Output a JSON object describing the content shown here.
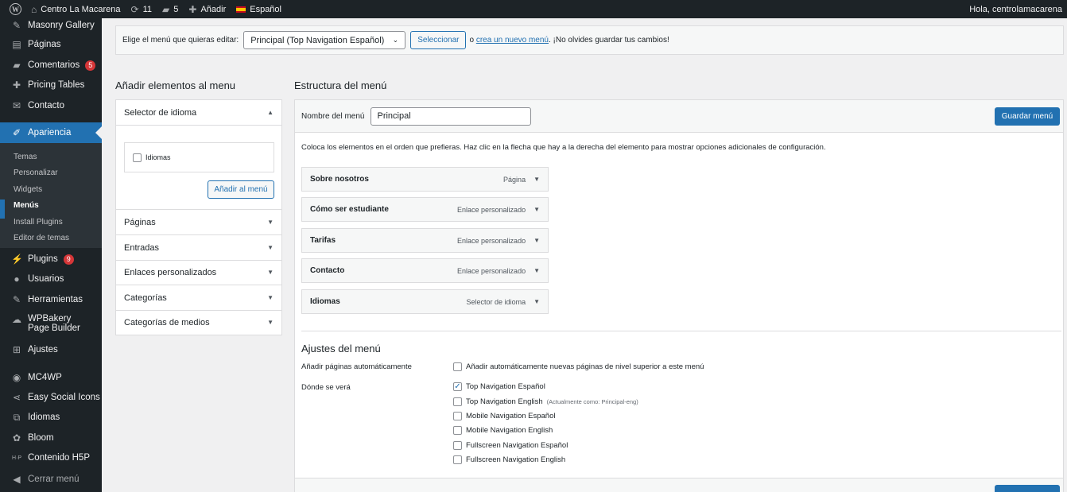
{
  "adminbar": {
    "site_name": "Centro La Macarena",
    "updates": "11",
    "comments": "5",
    "new_label": "Añadir",
    "language": "Español",
    "greeting": "Hola, centrolamacarena"
  },
  "sidebar": {
    "items": [
      {
        "label": "Masonry Gallery",
        "icon": "pin-icon"
      },
      {
        "label": "Páginas",
        "icon": "pages-icon"
      },
      {
        "label": "Comentarios",
        "icon": "comment-icon",
        "badge": "5"
      },
      {
        "label": "Pricing Tables",
        "icon": "plus-icon"
      },
      {
        "label": "Contacto",
        "icon": "mail-icon"
      },
      {
        "label": "Apariencia",
        "icon": "brush-icon"
      },
      {
        "label": "Plugins",
        "icon": "plugin-icon",
        "badge": "9"
      },
      {
        "label": "Usuarios",
        "icon": "user-icon"
      },
      {
        "label": "Herramientas",
        "icon": "wrench-icon"
      },
      {
        "label": "WPBakery Page Builder",
        "icon": "cloud-icon"
      },
      {
        "label": "Ajustes",
        "icon": "settings-icon"
      },
      {
        "label": "MC4WP",
        "icon": "mc4wp-icon"
      },
      {
        "label": "Easy Social Icons",
        "icon": "share-icon"
      },
      {
        "label": "Idiomas",
        "icon": "translate-icon"
      },
      {
        "label": "Bloom",
        "icon": "bloom-icon"
      },
      {
        "label": "Contenido H5P",
        "icon": "h5p-icon"
      },
      {
        "label": "Cerrar menú",
        "icon": "collapse-icon"
      }
    ],
    "submenu": [
      "Temas",
      "Personalizar",
      "Widgets",
      "Menús",
      "Install Plugins",
      "Editor de temas"
    ]
  },
  "select_menu": {
    "label": "Elige el menú que quieras editar:",
    "selected": "Principal (Top Navigation Español)",
    "select_button": "Seleccionar",
    "or_text": "o",
    "create_link": "crea un nuevo menú",
    "reminder": ". ¡No olvides guardar tus cambios!"
  },
  "add_items": {
    "title": "Añadir elementos al menu",
    "language_selector": "Selector de idioma",
    "language_option": "Idiomas",
    "add_button": "Añadir al menú",
    "sections": [
      "Páginas",
      "Entradas",
      "Enlaces personalizados",
      "Categorías",
      "Categorías de medios"
    ]
  },
  "structure": {
    "title": "Estructura del menú",
    "name_label": "Nombre del menú",
    "name_value": "Principal",
    "save_button": "Guardar menú",
    "instructions": "Coloca los elementos en el orden que prefieras. Haz clic en la flecha que hay a la derecha del elemento para mostrar opciones adicionales de configuración.",
    "items": [
      {
        "title": "Sobre nosotros",
        "type": "Página"
      },
      {
        "title": "Cómo ser estudiante",
        "type": "Enlace personalizado"
      },
      {
        "title": "Tarifas",
        "type": "Enlace personalizado"
      },
      {
        "title": "Contacto",
        "type": "Enlace personalizado"
      },
      {
        "title": "Idiomas",
        "type": "Selector de idioma"
      }
    ]
  },
  "settings": {
    "title": "Ajustes del menú",
    "auto_add_label": "Añadir páginas automáticamente",
    "auto_add_option": "Añadir automáticamente nuevas páginas de nivel superior a este menú",
    "location_label": "Dónde se verá",
    "locations": [
      {
        "label": "Top Navigation Español",
        "checked": true,
        "note": ""
      },
      {
        "label": "Top Navigation English",
        "checked": false,
        "note": "(Actualmente como: Principal-eng)"
      },
      {
        "label": "Mobile Navigation Español",
        "checked": false,
        "note": ""
      },
      {
        "label": "Mobile Navigation English",
        "checked": false,
        "note": ""
      },
      {
        "label": "Fullscreen Navigation Español",
        "checked": false,
        "note": ""
      },
      {
        "label": "Fullscreen Navigation English",
        "checked": false,
        "note": ""
      }
    ]
  }
}
